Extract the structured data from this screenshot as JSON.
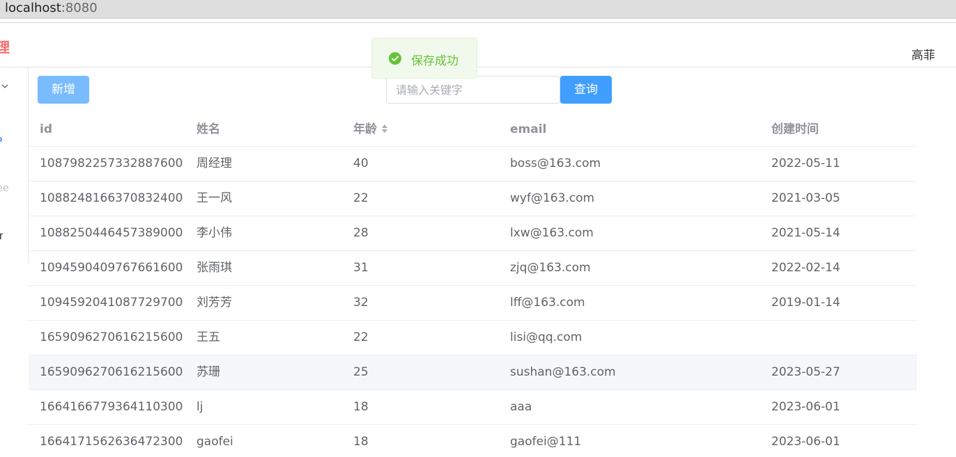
{
  "browser": {
    "host": "localhost",
    "port": ":8080"
  },
  "header": {
    "brand_fragment": "理",
    "user_name": "高菲"
  },
  "sidebar": {
    "item_fragment_1": "ee",
    "item_fragment_2": "r"
  },
  "toolbar": {
    "add_label": "新增",
    "search_placeholder": "请输入关键字",
    "search_label": "查询"
  },
  "toast": {
    "message": "保存成功",
    "icon": "check-circle-icon",
    "color": "#67c23a"
  },
  "table": {
    "columns": [
      "id",
      "姓名",
      "年龄",
      "email",
      "创建时间"
    ],
    "sortable_column": "年龄",
    "rows": [
      {
        "id": "1087982257332887600",
        "name": "周经理",
        "age": "40",
        "email": "boss@163.com",
        "created": "2022-05-11"
      },
      {
        "id": "1088248166370832400",
        "name": "王一风",
        "age": "22",
        "email": "wyf@163.com",
        "created": "2021-03-05"
      },
      {
        "id": "1088250446457389000",
        "name": "李小伟",
        "age": "28",
        "email": "lxw@163.com",
        "created": "2021-05-14"
      },
      {
        "id": "1094590409767661600",
        "name": "张雨琪",
        "age": "31",
        "email": "zjq@163.com",
        "created": "2022-02-14"
      },
      {
        "id": "1094592041087729700",
        "name": "刘芳芳",
        "age": "32",
        "email": "lff@163.com",
        "created": "2019-01-14"
      },
      {
        "id": "1659096270616215600",
        "name": "王五",
        "age": "22",
        "email": "lisi@qq.com",
        "created": ""
      },
      {
        "id": "1659096270616215600",
        "name": "苏珊",
        "age": "25",
        "email": "sushan@163.com",
        "created": "2023-05-27"
      },
      {
        "id": "1664166779364110300",
        "name": "lj",
        "age": "18",
        "email": "aaa",
        "created": "2023-06-01"
      },
      {
        "id": "1664171562636472300",
        "name": "gaofei",
        "age": "18",
        "email": "gaofei@111",
        "created": "2023-06-01"
      }
    ]
  },
  "colors": {
    "primary": "#409eff",
    "primary_light": "#79bbff",
    "danger": "#f56c6c",
    "success": "#67c23a"
  }
}
